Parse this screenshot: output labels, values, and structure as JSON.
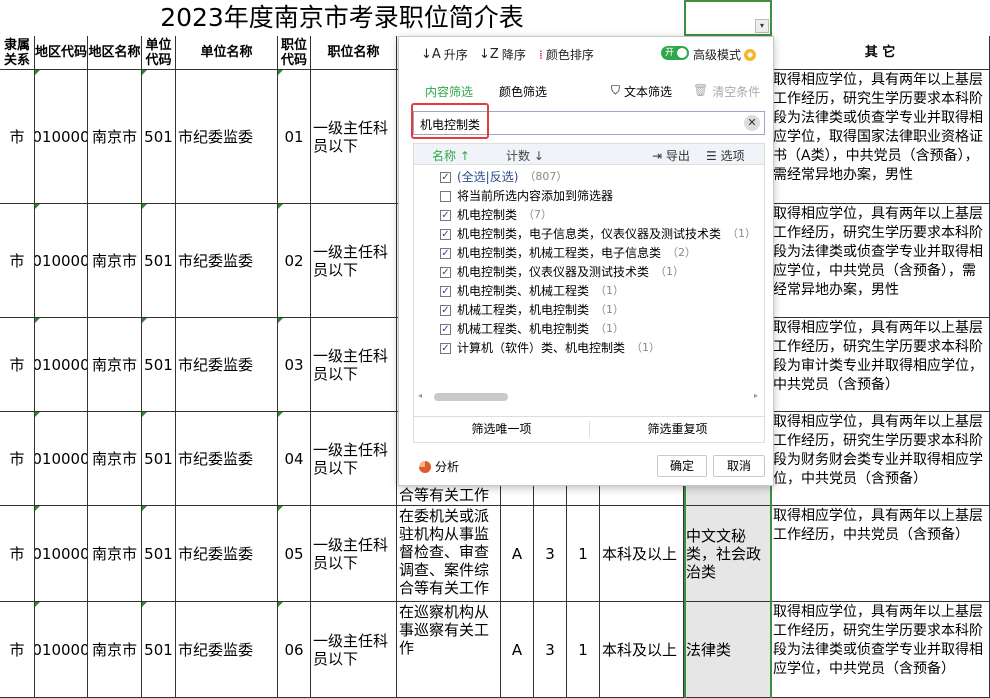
{
  "sheet": {
    "title": "2023年度南京市考录职位简介表",
    "headers": {
      "rel": "隶属关系",
      "area_code": "地区代码",
      "area_name": "地区名称",
      "unit_code": "单位代码",
      "unit_name": "单位名称",
      "pos_code": "职位代码",
      "pos_name": "职位名称",
      "other": "其 它"
    },
    "rows": [
      {
        "rel": "市",
        "area_code": "010000",
        "area_name": "南京市",
        "unit_code": "501",
        "unit_name": "市纪委监委",
        "pos_code": "01",
        "pos_name": "一级主任科员以下",
        "desc": "",
        "cat": "",
        "n1": "",
        "n2": "",
        "edu": "",
        "major": "",
        "other": "取得相应学位，具有两年以上基层工作经历，研究生学历要求本科阶段为法律类或侦查学专业并取得相应学位，取得国家法律职业资格证书（A类），中共党员（含预备），需经常异地办案，男性"
      },
      {
        "rel": "市",
        "area_code": "010000",
        "area_name": "南京市",
        "unit_code": "501",
        "unit_name": "市纪委监委",
        "pos_code": "02",
        "pos_name": "一级主任科员以下",
        "desc": "",
        "cat": "",
        "n1": "",
        "n2": "",
        "edu": "",
        "major": "",
        "other": "取得相应学位，具有两年以上基层工作经历，研究生学历要求本科阶段为法律类或侦查学专业并取得相应学位，中共党员（含预备），需经常异地办案，男性"
      },
      {
        "rel": "市",
        "area_code": "010000",
        "area_name": "南京市",
        "unit_code": "501",
        "unit_name": "市纪委监委",
        "pos_code": "03",
        "pos_name": "一级主任科员以下",
        "desc": "",
        "cat": "",
        "n1": "",
        "n2": "",
        "edu": "",
        "major": "",
        "other": "取得相应学位，具有两年以上基层工作经历，研究生学历要求本科阶段为审计类专业并取得相应学位，中共党员（含预备）"
      },
      {
        "rel": "市",
        "area_code": "010000",
        "area_name": "南京市",
        "unit_code": "501",
        "unit_name": "市纪委监委",
        "pos_code": "04",
        "pos_name": "一级主任科员以下",
        "desc": "合等有关工作",
        "cat": "",
        "n1": "",
        "n2": "",
        "edu": "",
        "major": "",
        "other": "取得相应学位，具有两年以上基层工作经历，研究生学历要求本科阶段为财务财会类专业并取得相应学位，中共党员（含预备）"
      },
      {
        "rel": "市",
        "area_code": "010000",
        "area_name": "南京市",
        "unit_code": "501",
        "unit_name": "市纪委监委",
        "pos_code": "05",
        "pos_name": "一级主任科员以下",
        "desc": "在委机关或派驻机构从事监督检查、审查调查、案件综合等有关工作",
        "cat": "A",
        "n1": "3",
        "n2": "1",
        "edu": "本科及以上",
        "major": "中文文秘类，社会政治类",
        "other": "取得相应学位，具有两年以上基层工作经历，中共党员（含预备）"
      },
      {
        "rel": "市",
        "area_code": "010000",
        "area_name": "南京市",
        "unit_code": "501",
        "unit_name": "市纪委监委",
        "pos_code": "06",
        "pos_name": "一级主任科员以下",
        "desc": "在巡察机构从事巡察有关工作",
        "cat": "A",
        "n1": "3",
        "n2": "1",
        "edu": "本科及以上",
        "major": "法律类",
        "other": "取得相应学位，具有两年以上基层工作经历，研究生学历要求本科阶段为法律类或侦查学专业并取得相应学位，中共党员（含预备）"
      }
    ]
  },
  "filter": {
    "toolbar": {
      "asc": "升序",
      "desc": "降序",
      "color_sort": "颜色排序",
      "toggle_on": "开",
      "advanced": "高级模式"
    },
    "tabs": {
      "content": "内容筛选",
      "color": "颜色筛选",
      "text_filter": "文本筛选",
      "clear": "清空条件"
    },
    "search_value": "机电控制类",
    "list_header": {
      "name": "名称",
      "count": "计数",
      "export": "导出",
      "options": "选项"
    },
    "items": [
      {
        "label": "(全选|反选)",
        "count": "（807）",
        "checked": true
      },
      {
        "label": "将当前所选内容添加到筛选器",
        "count": "",
        "checked": false
      },
      {
        "label": "机电控制类",
        "count": "（7）",
        "checked": true
      },
      {
        "label": "机电控制类，电子信息类，仪表仪器及测试技术类",
        "count": "（1）",
        "checked": true
      },
      {
        "label": "机电控制类，机械工程类，电子信息类",
        "count": "（2）",
        "checked": true
      },
      {
        "label": "机电控制类，仪表仪器及测试技术类",
        "count": "（1）",
        "checked": true
      },
      {
        "label": "机电控制类、机械工程类",
        "count": "（1）",
        "checked": true
      },
      {
        "label": "机械工程类，机电控制类",
        "count": "（1）",
        "checked": true
      },
      {
        "label": "机械工程类、机电控制类",
        "count": "（1）",
        "checked": true
      },
      {
        "label": "计算机（软件）类、机电控制类",
        "count": "（1）",
        "checked": true
      }
    ],
    "bottom": {
      "unique": "筛选唯一项",
      "duplicate": "筛选重复项"
    },
    "footer": {
      "analysis": "分析",
      "ok": "确定",
      "cancel": "取消"
    },
    "colors": {
      "accent": "#2fa84a",
      "highlight": "#e53c3c"
    }
  }
}
